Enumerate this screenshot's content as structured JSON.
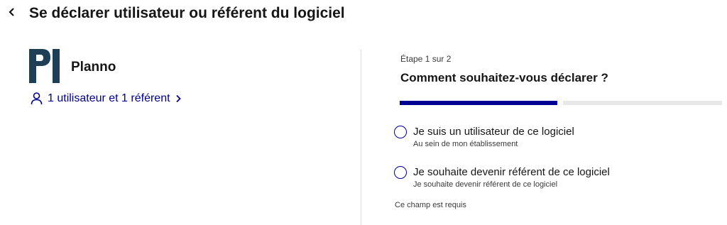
{
  "header": {
    "back_icon": "chevron-left-icon",
    "title": "Se déclarer utilisateur ou référent du logiciel"
  },
  "software": {
    "logo_letters": "Pl",
    "logo_color": "#1e3f55",
    "name": "Planno",
    "users_link": {
      "icon": "user-icon",
      "label": "1 utilisateur et 1 référent",
      "trailing_icon": "chevron-right-icon"
    }
  },
  "form": {
    "step_label": "Étape 1 sur 2",
    "title": "Comment souhaitez-vous déclarer ?",
    "stepper": {
      "current_step": 1,
      "total_steps": 2,
      "active_color": "#000091",
      "inactive_color": "#e8e8e8"
    },
    "options": [
      {
        "label": "Je suis un utilisateur de ce logiciel",
        "hint": "Au sein de mon établissement",
        "selected": false
      },
      {
        "label": "Je souhaite devenir référent de ce logiciel",
        "hint": "Je souhaite devenir référent de ce logiciel",
        "selected": false
      }
    ],
    "required_message": "Ce champ est requis"
  },
  "colors": {
    "accent": "#000091",
    "text": "#161616"
  }
}
